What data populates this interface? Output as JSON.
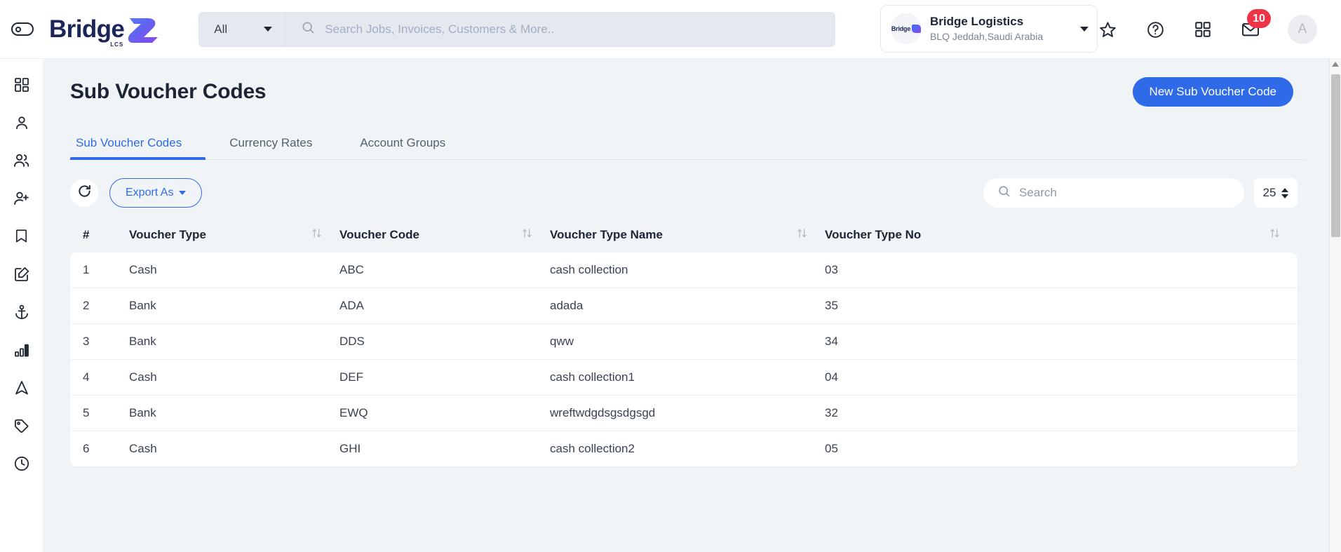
{
  "topbar": {
    "menu_toggle_name": "sidebar-toggle",
    "brand": {
      "name": "Bridge",
      "sub": "LCS"
    },
    "scope": {
      "selected": "All",
      "options": [
        "All"
      ]
    },
    "search": {
      "value": "",
      "placeholder": "Search Jobs, Invoices, Customers & More.."
    },
    "org": {
      "name": "Bridge Logistics",
      "location": "BLQ Jeddah,Saudi Arabia",
      "badge_text": "Bridge"
    },
    "icons": [
      {
        "name": "star-icon",
        "label": "Favorites"
      },
      {
        "name": "help-icon",
        "label": "Help"
      },
      {
        "name": "apps-grid-icon",
        "label": "Apps"
      },
      {
        "name": "mail-icon",
        "label": "Messages",
        "badge": "10"
      }
    ],
    "avatar": {
      "initial": "A"
    }
  },
  "sidebar": {
    "items": [
      {
        "name": "dashboard-icon",
        "label": "Dashboard"
      },
      {
        "name": "person-icon",
        "label": "Profile"
      },
      {
        "name": "people-icon",
        "label": "Customers"
      },
      {
        "name": "person-add-icon",
        "label": "Add Contact"
      },
      {
        "name": "bookmark-icon",
        "label": "Bookmarks"
      },
      {
        "name": "edit-square-icon",
        "label": "Jobs"
      },
      {
        "name": "anchor-icon",
        "label": "Shipping"
      },
      {
        "name": "bar-chart-icon",
        "label": "Reports"
      },
      {
        "name": "navigation-icon",
        "label": "Tracking"
      },
      {
        "name": "tag-icon",
        "label": "Rates"
      },
      {
        "name": "clock-icon",
        "label": "History"
      }
    ]
  },
  "page": {
    "title": "Sub Voucher Codes",
    "new_button": "New Sub Voucher Code"
  },
  "tabs": [
    {
      "label": "Sub Voucher Codes",
      "active": true
    },
    {
      "label": "Currency Rates",
      "active": false
    },
    {
      "label": "Account Groups",
      "active": false
    }
  ],
  "toolbar": {
    "refresh_label": "Refresh",
    "export_label": "Export As",
    "search": {
      "value": "",
      "placeholder": "Search"
    },
    "page_size": "25"
  },
  "table": {
    "columns": [
      {
        "key": "idx",
        "label": "#",
        "sortable": false
      },
      {
        "key": "voucher_type",
        "label": "Voucher Type",
        "sortable": true
      },
      {
        "key": "voucher_code",
        "label": "Voucher Code",
        "sortable": true
      },
      {
        "key": "voucher_type_name",
        "label": "Voucher Type Name",
        "sortable": true
      },
      {
        "key": "voucher_type_no",
        "label": "Voucher Type No",
        "sortable": true
      }
    ],
    "rows": [
      {
        "idx": "1",
        "voucher_type": "Cash",
        "voucher_code": "ABC",
        "voucher_type_name": "cash collection",
        "voucher_type_no": "03"
      },
      {
        "idx": "2",
        "voucher_type": "Bank",
        "voucher_code": "ADA",
        "voucher_type_name": "adada",
        "voucher_type_no": "35"
      },
      {
        "idx": "3",
        "voucher_type": "Bank",
        "voucher_code": "DDS",
        "voucher_type_name": "qww",
        "voucher_type_no": "34"
      },
      {
        "idx": "4",
        "voucher_type": "Cash",
        "voucher_code": "DEF",
        "voucher_type_name": "cash collection1",
        "voucher_type_no": "04"
      },
      {
        "idx": "5",
        "voucher_type": "Bank",
        "voucher_code": "EWQ",
        "voucher_type_name": "wreftwdgdsgsdgsgd",
        "voucher_type_no": "32"
      },
      {
        "idx": "6",
        "voucher_type": "Cash",
        "voucher_code": "GHI",
        "voucher_type_name": "cash collection2",
        "voucher_type_no": "05"
      }
    ]
  },
  "colors": {
    "accent": "#2f6ae8",
    "badge": "#f03247",
    "page_bg": "#f1f4f7",
    "brand_navy": "#1b2559"
  }
}
